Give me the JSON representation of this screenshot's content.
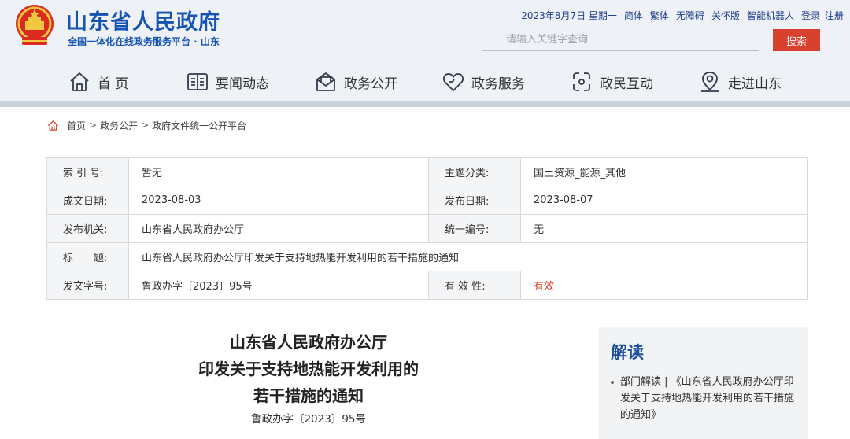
{
  "header": {
    "site_title": "山东省人民政府",
    "site_subtitle": "全国一体化在线政务服务平台 · 山东",
    "date": "2023年8月7日 星期一",
    "links": {
      "simplified": "简体",
      "traditional": "繁体",
      "accessible": "无障碍",
      "elderly": "关怀版",
      "robot": "智能机器人",
      "login": "登录",
      "register": "注册"
    },
    "search": {
      "placeholder": "请输入关键字查询",
      "button": "搜索"
    },
    "colors": {
      "brand_blue": "#1554b3",
      "search_red": "#d9412f"
    }
  },
  "nav": {
    "items": [
      {
        "label": "首 页",
        "icon": "home-icon"
      },
      {
        "label": "要闻动态",
        "icon": "book-icon"
      },
      {
        "label": "政务公开",
        "icon": "mail-icon"
      },
      {
        "label": "政务服务",
        "icon": "heart-icon"
      },
      {
        "label": "政民互动",
        "icon": "interaction-icon"
      },
      {
        "label": "走进山东",
        "icon": "map-pin-icon"
      }
    ]
  },
  "breadcrumb": {
    "home": "首页",
    "level1": "政务公开",
    "level2": "政府文件统一公开平台",
    "separator": ">"
  },
  "info": {
    "rows": [
      {
        "k1": "索 引 号:",
        "v1": "暂无",
        "k2": "主题分类:",
        "v2": "国土资源_能源_其他"
      },
      {
        "k1": "成文日期:",
        "v1": "2023-08-03",
        "k2": "发布日期:",
        "v2": "2023-08-07"
      },
      {
        "k1": "发布机关:",
        "v1": "山东省人民政府办公厅",
        "k2": "统一编号:",
        "v2": "无"
      },
      {
        "k1": "标　　题:",
        "v1": "山东省人民政府办公厅印发关于支持地热能开发利用的若干措施的通知"
      },
      {
        "k1": "发文字号:",
        "v1": "鲁政办字〔2023〕95号",
        "k2": "有 效 性:",
        "v2": "有效"
      }
    ]
  },
  "document": {
    "title_line1": "山东省人民政府办公厅",
    "title_line2": "印发关于支持地热能开发利用的",
    "title_line3": "若干措施的通知",
    "number": "鲁政办字〔2023〕95号"
  },
  "side": {
    "title": "解读",
    "item": "部门解读 | 《山东省人民政府办公厅印发关于支持地热能开发利用的若干措施的通知》"
  }
}
